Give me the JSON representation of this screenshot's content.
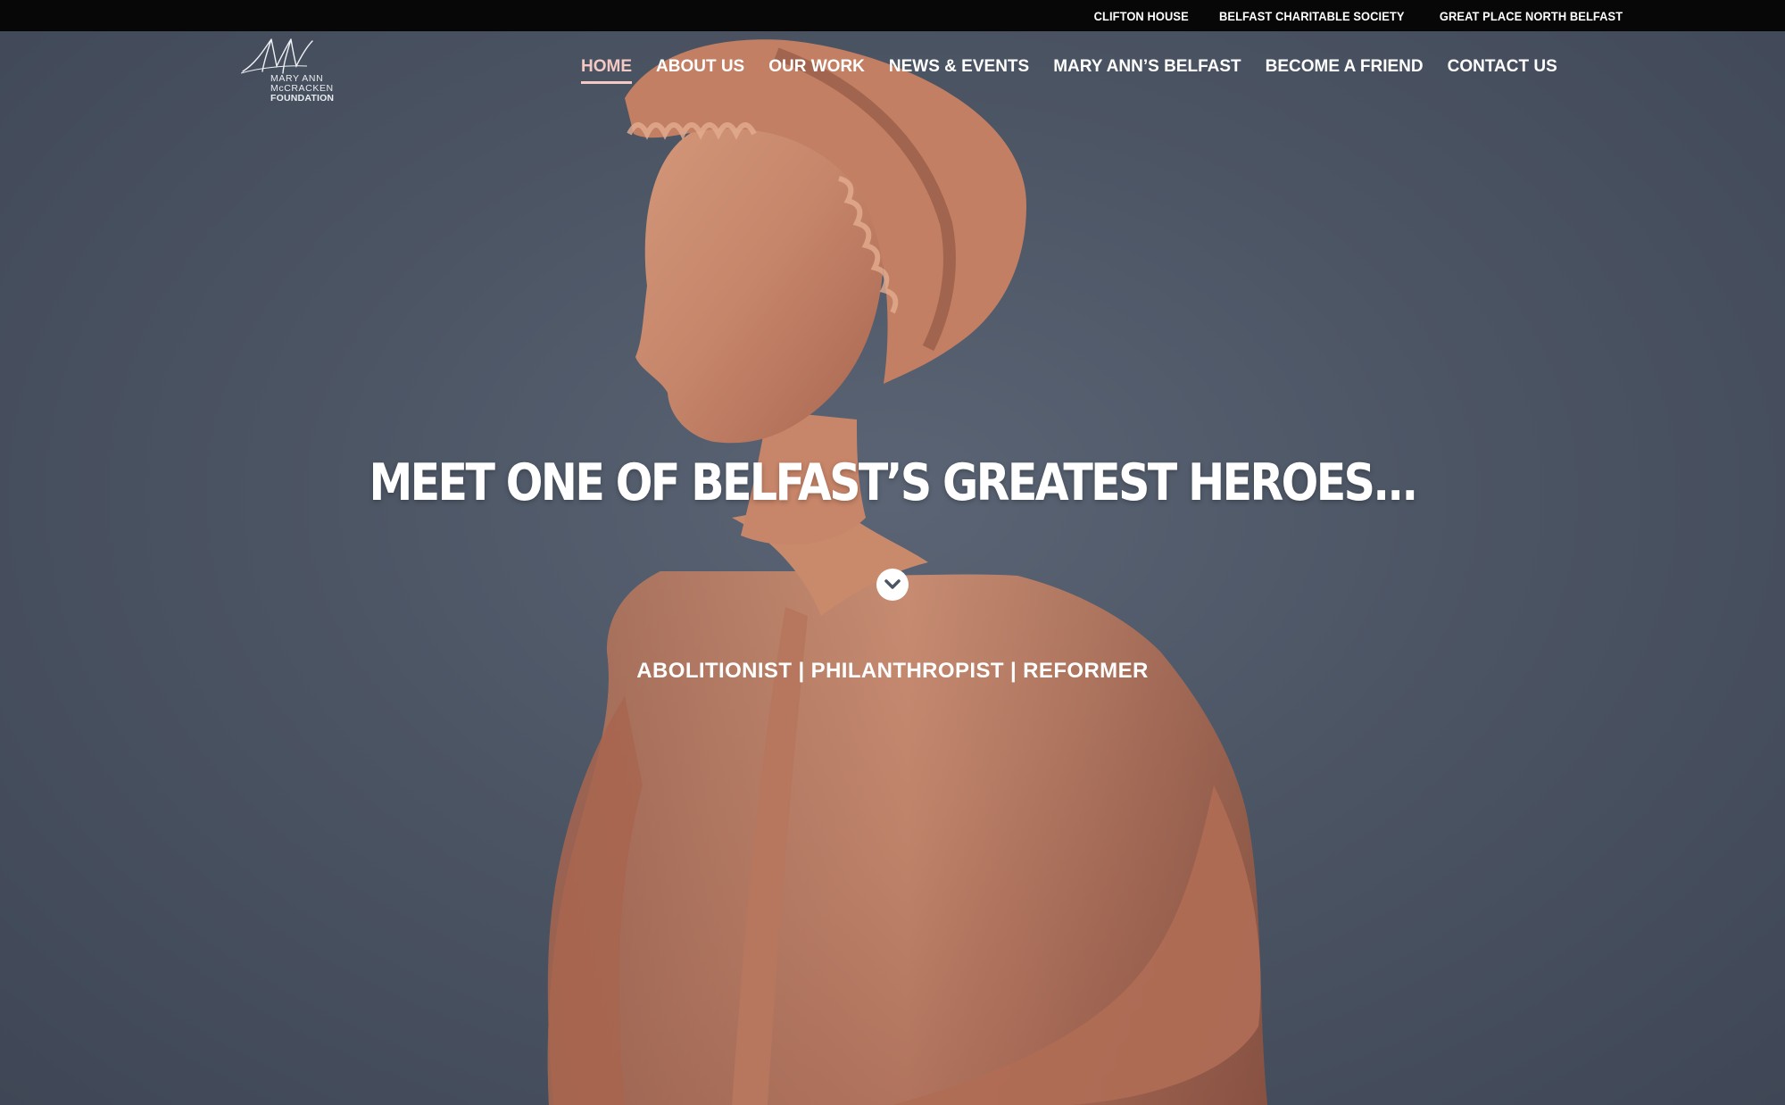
{
  "topbar": {
    "links": [
      "CLIFTON HOUSE",
      "BELFAST CHARITABLE SOCIETY",
      "GREAT PLACE NORTH BELFAST"
    ]
  },
  "logo": {
    "line1": "MARY ANN",
    "line2": "McCRACKEN",
    "line3": "FOUNDATION"
  },
  "nav": {
    "items": [
      "HOME",
      "ABOUT US",
      "OUR WORK",
      "NEWS & EVENTS",
      "MARY ANN’S BELFAST",
      "BECOME A FRIEND",
      "CONTACT US"
    ],
    "active": "HOME",
    "active_color": "#f2c9c3"
  },
  "hero": {
    "title": "MEET ONE OF BELFAST’S GREATEST HEROES...",
    "subtitle": "ABOLITIONIST | PHILANTHROPIST | REFORMER",
    "scroll_icon": "chevron-down-icon"
  },
  "colors": {
    "background": "#4c5564",
    "topbar": "#070707",
    "statue": "#c98a6c"
  }
}
